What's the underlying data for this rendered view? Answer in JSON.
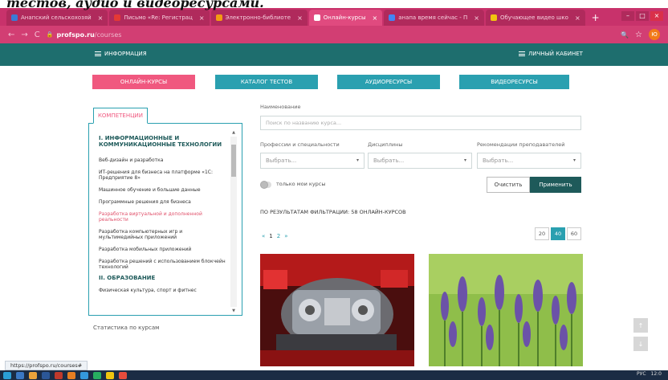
{
  "caption": "тестов, аудио и видеоресурсами.",
  "browser": {
    "tabs": [
      {
        "label": "Анапский сельскохозяй",
        "color": "#3a7bd5",
        "active": false
      },
      {
        "label": "Письмо «Re: Регистрац",
        "color": "#e53935",
        "active": false
      },
      {
        "label": "Электронно-библиоте",
        "color": "#f39c12",
        "active": false
      },
      {
        "label": "Онлайн-курсы",
        "color": "#ffffff",
        "active": true
      },
      {
        "label": "анапа время сейчас - П",
        "color": "#4285f4",
        "active": false
      },
      {
        "label": "Обучающее видео шко",
        "color": "#f1c40f",
        "active": false
      }
    ],
    "new_tab": "+",
    "tab_close": "×",
    "window_controls": {
      "min": "–",
      "max": "□",
      "close": "×"
    },
    "nav": {
      "back": "←",
      "forward": "→",
      "reload": "C"
    },
    "url_domain": "profspo.ru",
    "url_path": "/courses",
    "lock_icon": "🔒",
    "search_icon": "🔍",
    "star_icon": "☆",
    "avatar": "Ю"
  },
  "site_header": {
    "menu_left": "ИНФОРМАЦИЯ",
    "menu_right": "ЛИЧНЫЙ КАБИНЕТ"
  },
  "nav_buttons": [
    "ОНЛАЙН-КУРСЫ",
    "КАТАЛОГ ТЕСТОВ",
    "АУДИОРЕСУРСЫ",
    "ВИДЕОРЕСУРСЫ"
  ],
  "sidebar": {
    "tab_label": "КОМПЕТЕНЦИИ",
    "cat1": "I. ИНФОРМАЦИОННЫЕ И КОММУНИКАЦИОННЫЕ ТЕХНОЛОГИИ",
    "items1": [
      "Веб-дизайн и разработка",
      "ИТ-решения для бизнеса на платформе «1С: Предприятие 8»",
      "Машинное обучение и большие данные",
      "Программные решения для бизнеса",
      "Разработка виртуальной и дополненной реальности",
      "Разработка компьютерных игр и мультимедийных приложений",
      "Разработка мобильных приложений",
      "Разработка решений с использованием блокчейн технологий"
    ],
    "cat2": "II. ОБРАЗОВАНИЕ",
    "items2": [
      "Физическая культура, спорт и фитнес"
    ],
    "highlight_color": "#e0506a",
    "stats_link": "Статистика по курсам"
  },
  "filters": {
    "name_label": "Наименование",
    "name_placeholder": "Поиск по названию курса...",
    "prof_label": "Профессии и специальности",
    "disc_label": "Дисциплины",
    "rec_label": "Рекомендации преподавателей",
    "select_placeholder": "Выбрать...",
    "caret": "▾",
    "only_mine": "только мои курсы",
    "clear": "Очистить",
    "apply": "Применить"
  },
  "results_text": "ПО РЕЗУЛЬТАТАМ ФИЛЬТРАЦИИ: 58 ОНЛАЙН-КУРСОВ",
  "pager": {
    "prev": "«",
    "pages": [
      "1",
      "2"
    ],
    "next": "»"
  },
  "per_page": [
    "20",
    "40",
    "60"
  ],
  "per_page_active": "40",
  "float_buttons": {
    "up": "↑",
    "down": "↓"
  },
  "status_url": "https://profspo.ru/courses#",
  "taskbar_right": {
    "lang": "РУС",
    "time": "12:0"
  },
  "colors": {
    "accent_pink": "#f0587f",
    "teal": "#2aa0b0",
    "dark_teal": "#1e5a5a",
    "header_teal": "#1e6e6e",
    "browser_pink": "#c8326b"
  }
}
